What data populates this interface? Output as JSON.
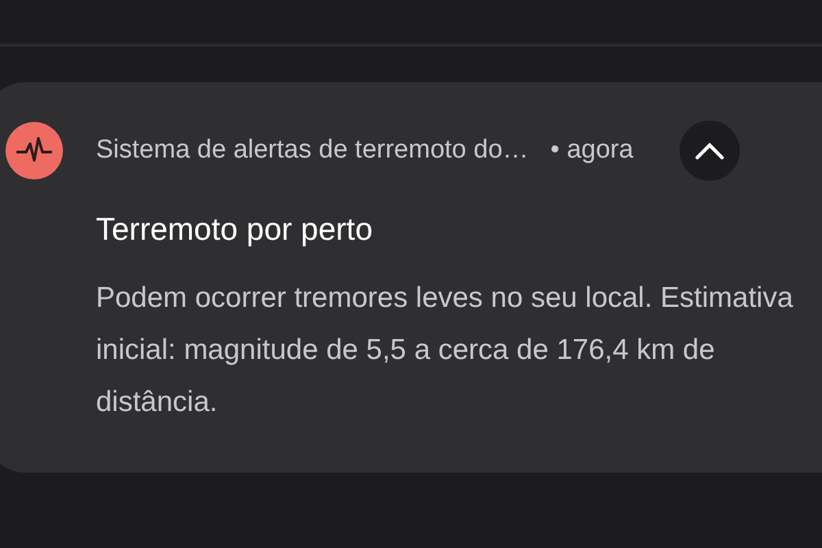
{
  "notification": {
    "app_name": "Sistema de alertas de terremoto do…",
    "time": "• agora",
    "expanded": true,
    "title": "Terremoto por perto",
    "body": "Podem ocorrer tremores leves no seu local. Estimativa inicial: magnitude de 5,5 a cerca de 176,4 km de distância."
  }
}
